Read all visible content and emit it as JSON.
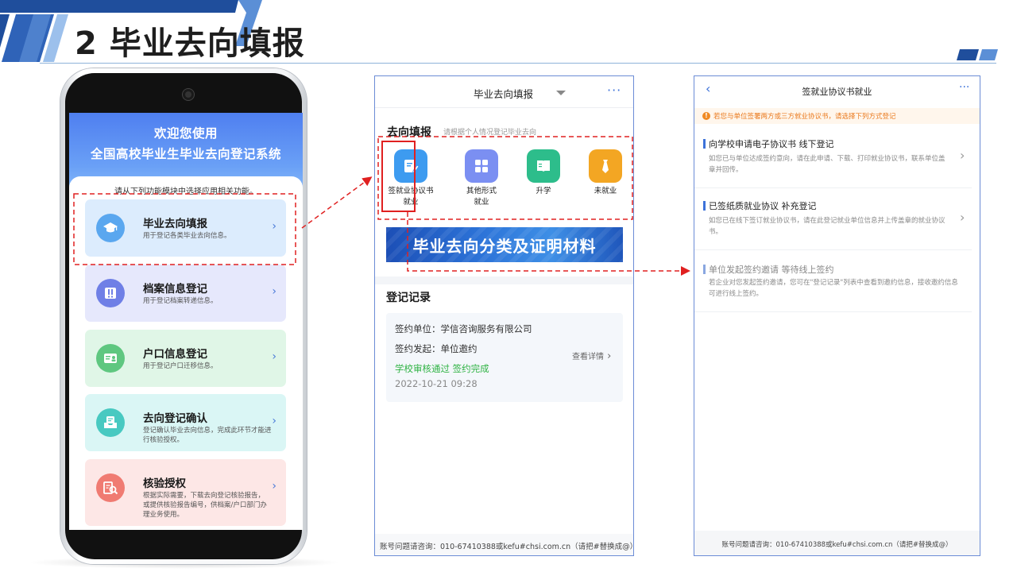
{
  "slide": {
    "title": "2 毕业去向填报"
  },
  "phone": {
    "banner_line1": "欢迎您使用",
    "banner_line2": "全国高校毕业生毕业去向登记系统",
    "hint": "请从下列功能模块中选择应用相关功能。",
    "items": [
      {
        "title": "毕业去向填报",
        "desc": "用于登记各类毕业去向信息。",
        "icon": "graduation-cap-icon",
        "bg": "#dcecfd",
        "icon_bg": "#5aa7ef"
      },
      {
        "title": "档案信息登记",
        "desc": "用于登记档案转递信息。",
        "icon": "archive-icon",
        "bg": "#e6e8fc",
        "icon_bg": "#6f7fe6"
      },
      {
        "title": "户口信息登记",
        "desc": "用于登记户口迁移信息。",
        "icon": "id-card-icon",
        "bg": "#e0f6e7",
        "icon_bg": "#5fc780"
      },
      {
        "title": "去向登记确认",
        "desc": "登记确认毕业去向信息，完成此环节才能进行核验授权。",
        "icon": "confirm-icon",
        "bg": "#daf6f5",
        "icon_bg": "#48c9c1"
      },
      {
        "title": "核验授权",
        "desc": "根据实际需要，下载去向登记核验报告，或提供核验报告编号，供档案/户口部门办理业务使用。",
        "icon": "verify-icon",
        "bg": "#fde7e6",
        "icon_bg": "#f07b72"
      }
    ]
  },
  "middle": {
    "title": "毕业去向填报",
    "more": "···",
    "section_title": "去向填报",
    "section_sub": "请根据个人情况登记毕业去向",
    "options": [
      {
        "label1": "签就业协议书",
        "label2": "就业",
        "icon": "edit-icon",
        "color": "#3d9bf0"
      },
      {
        "label1": "其他形式",
        "label2": "就业",
        "icon": "grid-icon",
        "color": "#7b8ff2"
      },
      {
        "label1": "升学",
        "label2": "",
        "icon": "book-icon",
        "color": "#2dbd8b"
      },
      {
        "label1": "未就业",
        "label2": "",
        "icon": "tie-icon",
        "color": "#f3a623"
      }
    ],
    "banner_text": "毕业去向分类及证明材料",
    "record_title": "登记记录",
    "record": {
      "unit": "签约单位：学信咨询服务有限公司",
      "initiator": "签约发起：单位邀约",
      "status": "学校审核通过 签约完成",
      "time": "2022-10-21 09:28",
      "detail": "查看详情"
    },
    "footer": "账号问题请咨询：010-67410388或kefu#chsi.com.cn（请把#替换成@）"
  },
  "right": {
    "back": "‹",
    "title": "签就业协议书就业",
    "more": "···",
    "notice": "若您与单位签署两方或三方就业协议书，请选择下列方式登记",
    "items": [
      {
        "title": "向学校申请电子协议书 线下登记",
        "desc1": "如您已与单位达成签约意向，请在此申请、下载、打印就业协议书，联系单位盖",
        "desc2": "章并回传。"
      },
      {
        "title": "已签纸质就业协议 补充登记",
        "desc1": "如您已在线下签订就业协议书，请在此登记就业单位信息并上传盖章的就业协议",
        "desc2": "书。"
      },
      {
        "title": "单位发起签约邀请 等待线上签约",
        "desc1": "若企业对您发起签约邀请，您可在\"登记记录\"列表中查看到邀约信息，接收邀约信息",
        "desc2": "可进行线上签约。"
      }
    ],
    "footer": "账号问题请咨询：010-67410388或kefu#chsi.com.cn（请把#替换成@）"
  },
  "colors": {
    "accent": "#3d72d9",
    "annotation": "#e02020",
    "success": "#2fb344",
    "warning": "#ea7a1e"
  }
}
